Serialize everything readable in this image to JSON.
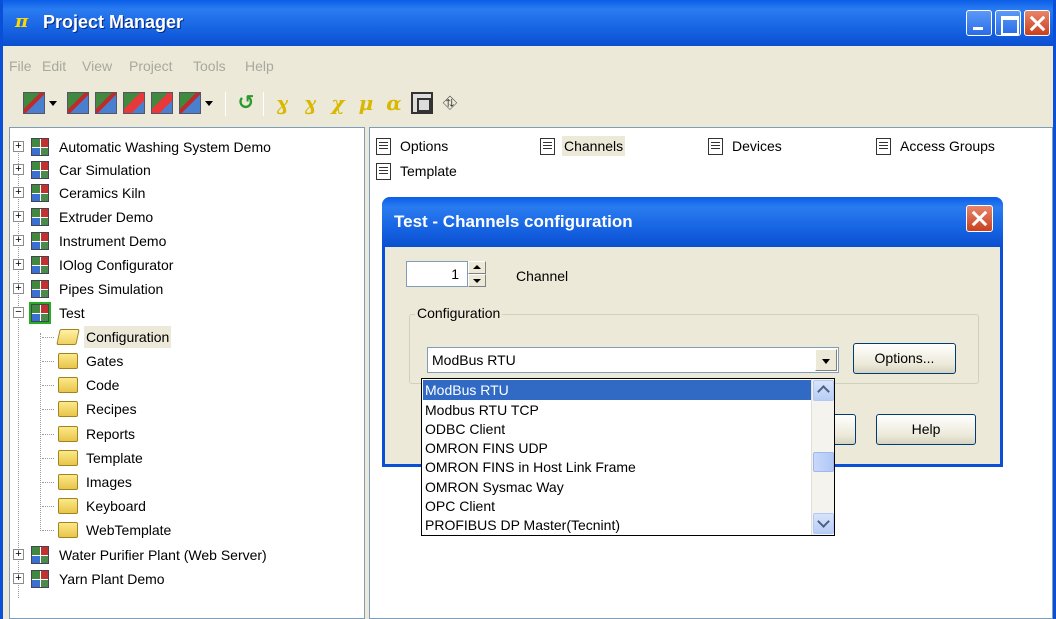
{
  "window": {
    "title": "Project Manager",
    "icon": "pi-icon",
    "app_glyph": "π"
  },
  "menu": [
    "File",
    "Edit",
    "View",
    "Project",
    "Tools",
    "Help"
  ],
  "toolbar": {
    "glyphs": [
      "↺",
      "ɣ",
      "ɣ",
      "χ",
      "μ",
      "α",
      "⊠",
      "⛗"
    ]
  },
  "tree": {
    "projects": [
      {
        "label": "Automatic Washing System Demo",
        "expander": "+"
      },
      {
        "label": "Car Simulation",
        "expander": "+"
      },
      {
        "label": "Ceramics Kiln",
        "expander": "+"
      },
      {
        "label": "Extruder Demo",
        "expander": "+"
      },
      {
        "label": "Instrument Demo",
        "expander": "+"
      },
      {
        "label": "IOlog Configurator",
        "expander": "+"
      },
      {
        "label": "Pipes Simulation",
        "expander": "+"
      },
      {
        "label": "Test",
        "expander": "−"
      },
      {
        "label": "Water Purifier Plant (Web Server)",
        "expander": "+"
      },
      {
        "label": "Yarn Plant Demo",
        "expander": "+"
      }
    ],
    "test_children": [
      {
        "label": "Configuration",
        "selected": true
      },
      {
        "label": "Gates"
      },
      {
        "label": "Code"
      },
      {
        "label": "Recipes"
      },
      {
        "label": "Reports"
      },
      {
        "label": "Template"
      },
      {
        "label": "Images"
      },
      {
        "label": "Keyboard"
      },
      {
        "label": "WebTemplate"
      }
    ]
  },
  "content_items": [
    {
      "label": "Options"
    },
    {
      "label": "Channels",
      "selected": true
    },
    {
      "label": "Devices"
    },
    {
      "label": "Access Groups"
    },
    {
      "label": "Template"
    }
  ],
  "dialog": {
    "title": "Test - Channels configuration",
    "channel_value": "1",
    "channel_label": "Channel",
    "group_label": "Configuration",
    "combo_value": "ModBus RTU",
    "options_button": "Options...",
    "ok_button": "",
    "help_button": "Help"
  },
  "dropdown": {
    "items": [
      "ModBus RTU",
      "Modbus RTU TCP",
      "ODBC Client",
      "OMRON FINS UDP",
      "OMRON FINS in Host Link Frame",
      "OMRON Sysmac Way",
      "OPC Client",
      "PROFIBUS DP Master(Tecnint)"
    ],
    "selected_index": 0,
    "scroll_position": 0.5
  },
  "colors": {
    "title_bar": "#0a5ee8",
    "selection": "#316ac5",
    "window_bg": "#ece9d8"
  }
}
